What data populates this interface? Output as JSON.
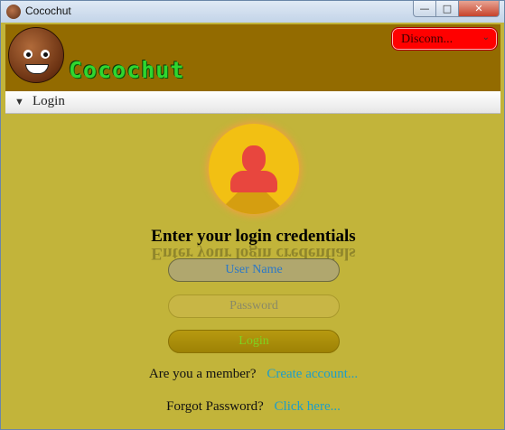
{
  "window": {
    "title": "Cocochut",
    "minimize": "—",
    "maximize": "□",
    "close": "✕"
  },
  "header": {
    "brand": "Cocochut",
    "disconnect_label": "Disconn..."
  },
  "section": {
    "label": "Login"
  },
  "login": {
    "heading": "Enter your login credentials",
    "username_placeholder": "User Name",
    "password_placeholder": "Password",
    "login_button": "Login",
    "member_question": "Are you a member?",
    "create_account_link": "Create account...",
    "forgot_question": "Forgot Password?",
    "click_here_link": "Click here..."
  },
  "colors": {
    "header_bg": "#936b00",
    "panel_bg": "#c2b43a",
    "disconnect_bg": "#ff0000",
    "avatar_bg": "#f2c013",
    "link": "#1e9ec8"
  }
}
